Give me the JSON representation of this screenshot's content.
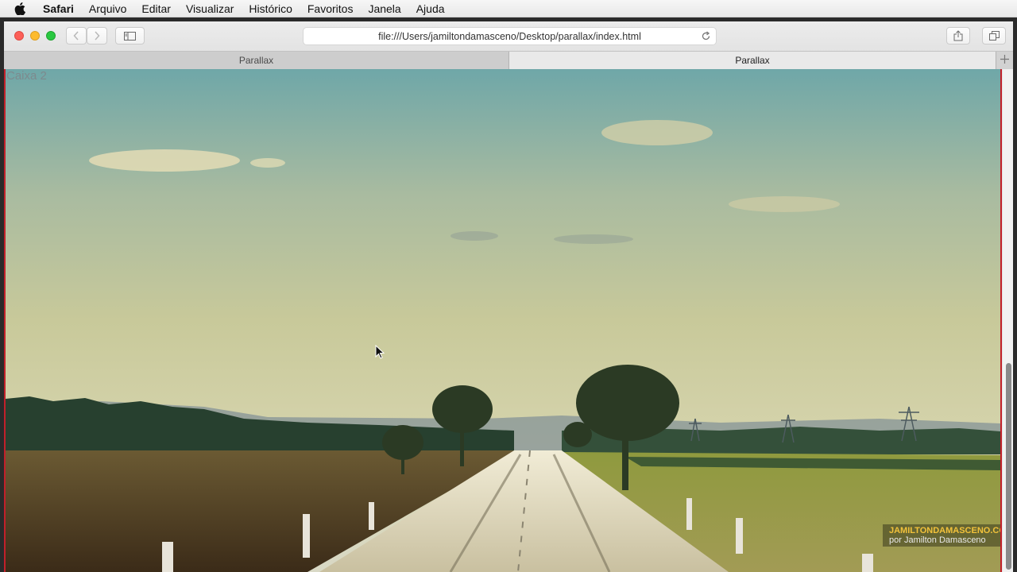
{
  "menubar": {
    "app_name": "Safari",
    "items": [
      "Arquivo",
      "Editar",
      "Visualizar",
      "Histórico",
      "Favoritos",
      "Janela",
      "Ajuda"
    ]
  },
  "toolbar": {
    "url": "file:///Users/jamiltondamasceno/Desktop/parallax/index.html"
  },
  "tabs": [
    {
      "label": "Parallax",
      "active": false
    },
    {
      "label": "Parallax",
      "active": true
    }
  ],
  "content": {
    "box_label": "Caixa 2",
    "watermark_line1": "JAMILTONDAMASCENO.COM",
    "watermark_line2": "por Jamilton Damasceno"
  },
  "icons": {
    "apple": "apple-logo-icon",
    "back": "chevron-left-icon",
    "forward": "chevron-right-icon",
    "sidebar": "sidebar-icon",
    "reload": "reload-icon",
    "share": "share-icon",
    "tabs_overview": "tabs-overview-icon",
    "new_tab": "plus-icon"
  },
  "colors": {
    "close": "#fc5f57",
    "minimize": "#fdbb2e",
    "maximize": "#29c840",
    "section_border": "#c2202a"
  }
}
